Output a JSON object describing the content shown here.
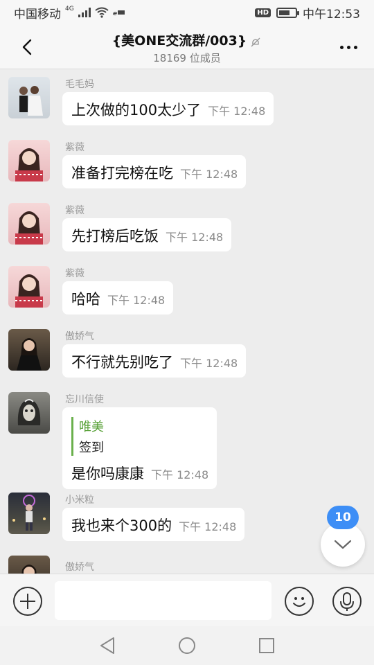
{
  "status_bar": {
    "carrier": "中国移动",
    "network": "4G",
    "time": "中午12:53",
    "hd_label": "HD",
    "battery_level": 0.7
  },
  "header": {
    "title": "{美ONE交流群/003}",
    "member_count": "18169 位成员",
    "icons": [
      "back-icon",
      "mute-icon",
      "more-icon"
    ]
  },
  "messages": [
    {
      "sender": "毛毛妈",
      "text": "上次做的100太少了",
      "time": "下午 12:48"
    },
    {
      "sender": "紫薇",
      "text": "准备打完榜在吃",
      "time": "下午 12:48"
    },
    {
      "sender": "紫薇",
      "text": "先打榜后吃饭",
      "time": "下午 12:48"
    },
    {
      "sender": "紫薇",
      "text": "哈哈",
      "time": "下午 12:48"
    },
    {
      "sender": "傲娇气",
      "text": "不行就先别吃了",
      "time": "下午 12:48"
    },
    {
      "sender": "忘川信使",
      "quote_name": "唯美",
      "quote_text": "签到",
      "text": "是你吗康康",
      "time": "下午 12:48"
    },
    {
      "sender": "小米粒",
      "text": "我也来个300的",
      "time": "下午 12:48"
    },
    {
      "sender": "傲娇气"
    }
  ],
  "unread_badge": "10",
  "input_bar": {
    "placeholder": "",
    "icons": [
      "plus-icon",
      "emoji-icon",
      "voice-icon"
    ]
  },
  "nav_bar": {
    "icons": [
      "nav-back-icon",
      "nav-home-icon",
      "nav-recents-icon"
    ]
  }
}
